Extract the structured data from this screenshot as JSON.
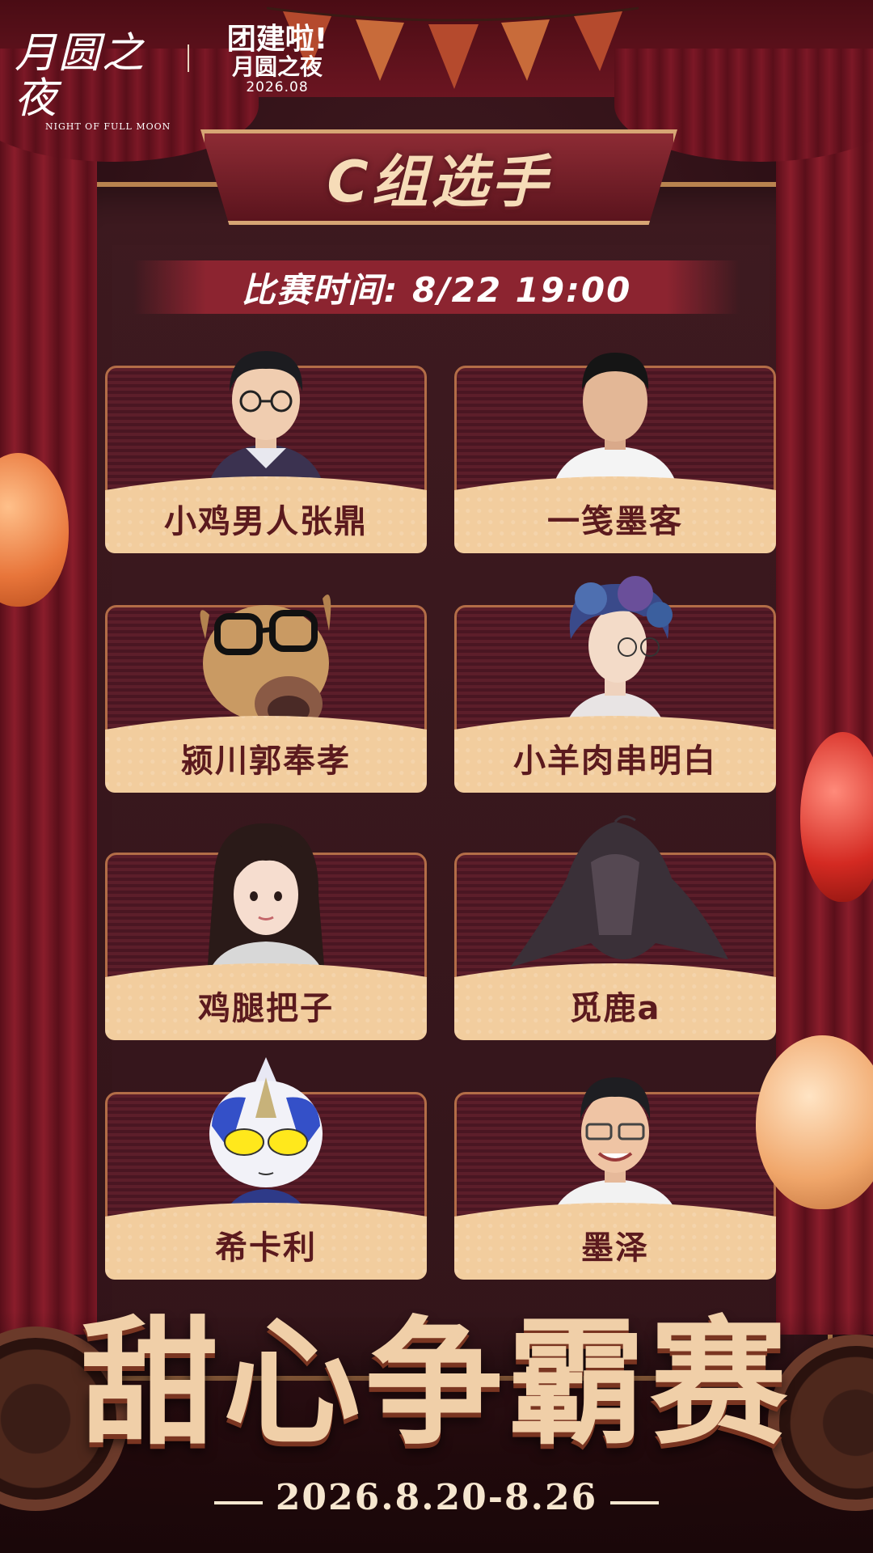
{
  "header": {
    "logo_left_main": "月圆之夜",
    "logo_left_sub": "NIGHT OF FULL MOON",
    "logo_right_line1": "团建啦!",
    "logo_right_line2": "月圆之夜",
    "logo_right_line3": "2026.08"
  },
  "group_title": "C组选手",
  "match_time": "比赛时间: 8/22 19:00",
  "players": [
    {
      "name": "小鸡男人张鼎",
      "avatar": "man-with-glasses-photo"
    },
    {
      "name": "一笺墨客",
      "avatar": "young-man-photo"
    },
    {
      "name": "颍川郭奉孝",
      "avatar": "dog-with-glasses-photo"
    },
    {
      "name": "小羊肉串明白",
      "avatar": "blue-hair-illustration"
    },
    {
      "name": "鸡腿把子",
      "avatar": "woman-long-hair-photo"
    },
    {
      "name": "觅鹿a",
      "avatar": "dark-hair-character-illustration"
    },
    {
      "name": "希卡利",
      "avatar": "ultraman-chibi"
    },
    {
      "name": "墨泽",
      "avatar": "smiling-man-glasses-photo"
    }
  ],
  "event_title": "甜心争霸赛",
  "event_dates": "2026.8.20-8.26",
  "colors": {
    "background": "#321218",
    "curtain": "#7c1826",
    "frame": "#b9834f",
    "card_name_bg": "#f2cd9e",
    "card_name_text": "#5b1a1e",
    "title_text": "#f0cfa8"
  }
}
